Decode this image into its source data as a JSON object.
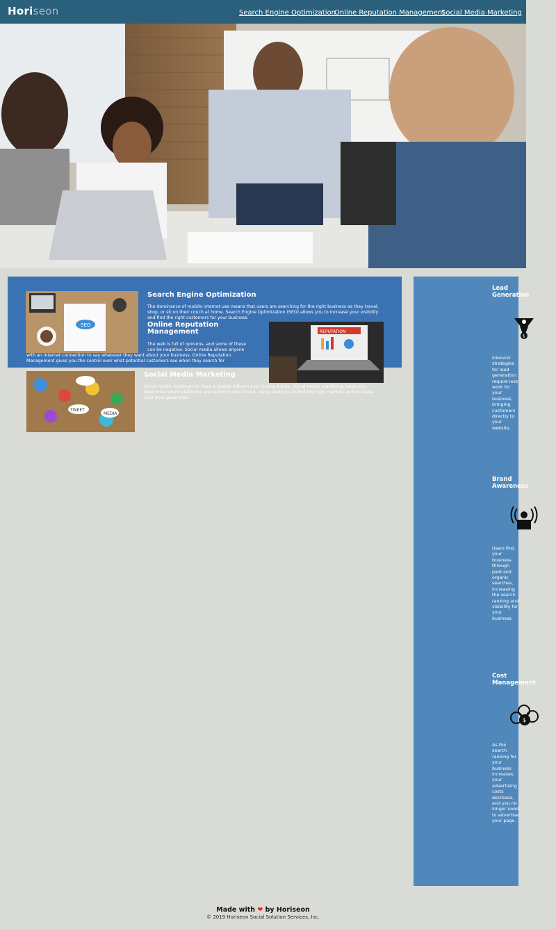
{
  "header": {
    "logo_part1": "Hori",
    "logo_part2": "seon",
    "nav": [
      {
        "label": "Search Engine Optimization"
      },
      {
        "label": "Online Reputation Management"
      },
      {
        "label": "Social Media Marketing"
      }
    ]
  },
  "sections": {
    "seo": {
      "title": "Search Engine Optimization",
      "body": "The dominance of mobile internet use means that users are searching for the right business as they travel, shop, or sit on their couch at home. Search Engine Optimization (SEO) allows you to increase your visibility and find the right customers for your business."
    },
    "orm": {
      "title_line1": "Online Reputation",
      "title_line2": "Management",
      "body_line1": "The web is full of opinions, and some of these",
      "body_line2": "can be negative. Social media allows anyone",
      "body_line3": "with an internet connection to say whatever they want about your business. Online Reputation",
      "body_line4": "Management gives you the control over what potential customers see when they search for"
    },
    "smm": {
      "title": "Social Media Marketing",
      "body": "Social media continues to have a sizable influence on buying habits. Social media marketing helps you determine which platforms are suited to your brand, using analytics to find the right markets and increase your lead generation."
    }
  },
  "aside": {
    "lead": {
      "title_line1": "Lead",
      "title_line2": "Generation",
      "body": "Inbound strategies for lead generation require less work for your business, bringing customers directly to your website."
    },
    "brand": {
      "title_line1": "Brand",
      "title_line2": "Awareness",
      "body": "Users find your business through paid and organic searches, increasing the search ranking and visibility for your business."
    },
    "cost": {
      "title_line1": "Cost",
      "title_line2": "Management",
      "body": "As the search ranking for your business increases, your advertising costs decrease, and you no longer need to advertise your page."
    }
  },
  "footer": {
    "made_prefix": "Made with",
    "heart": "❤",
    "made_suffix": "by Horiseon",
    "copyright": "© 2019 Horiseon Social Solution Services, Inc."
  }
}
